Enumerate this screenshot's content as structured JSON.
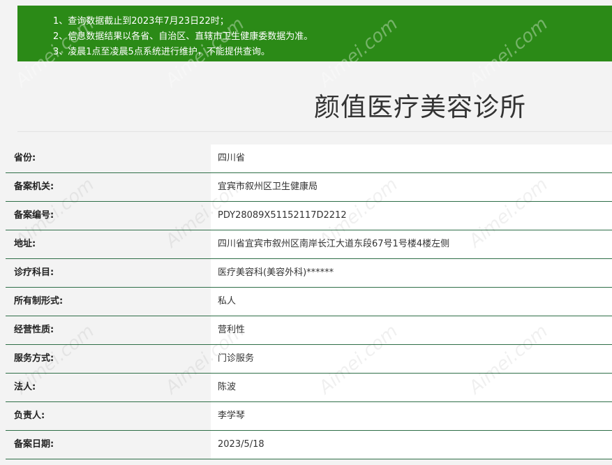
{
  "notice": {
    "lines": [
      "1、查询数据截止到2023年7月23日22时；",
      "2、信息数据结果以各省、自治区、直辖市卫生健康委数据为准。",
      "3、凌晨1点至凌晨5点系统进行维护，不能提供查询。"
    ]
  },
  "title": "颜值医疗美容诊所",
  "records": [
    {
      "label": "省份:",
      "value": "四川省"
    },
    {
      "label": "备案机关:",
      "value": "宜宾市叙州区卫生健康局"
    },
    {
      "label": "备案编号:",
      "value": "PDY28089X51152117D2212"
    },
    {
      "label": "地址:",
      "value": "四川省宜宾市叙州区南岸长江大道东段67号1号楼4楼左侧"
    },
    {
      "label": "诊疗科目:",
      "value": "医疗美容科(美容外科)******"
    },
    {
      "label": "所有制形式:",
      "value": "私人"
    },
    {
      "label": "经营性质:",
      "value": "营利性"
    },
    {
      "label": "服务方式:",
      "value": "门诊服务"
    },
    {
      "label": "法人:",
      "value": "陈波"
    },
    {
      "label": "负责人:",
      "value": "李学琴"
    },
    {
      "label": "备案日期:",
      "value": "2023/5/18"
    }
  ],
  "watermark": {
    "text": "Aimei.com"
  },
  "colors": {
    "notice_bg": "#2b8a17",
    "row_divider": "#2e6e47"
  }
}
